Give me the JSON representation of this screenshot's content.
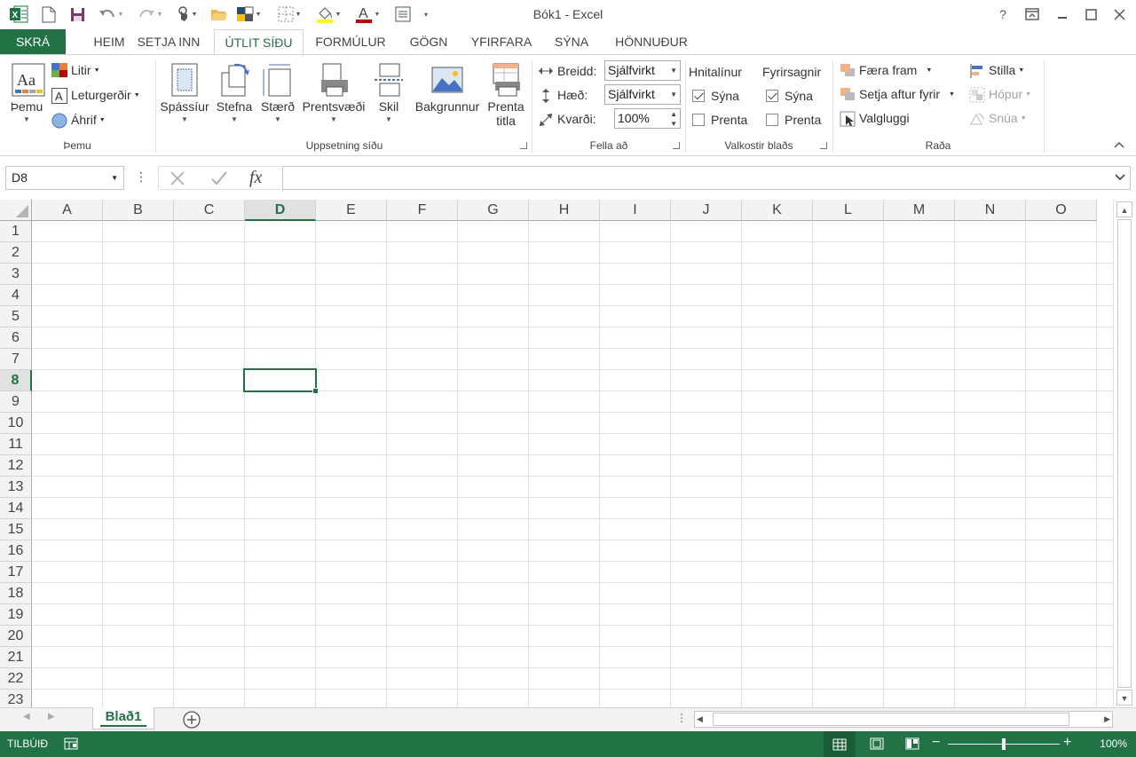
{
  "window": {
    "title": "Bók1 - Excel",
    "help": "?",
    "restore_ribbon": "⧉",
    "minimize": "—",
    "maximize": "☐",
    "close": "✕"
  },
  "tabs": [
    {
      "label": "SKRÁ"
    },
    {
      "label": "HEIM"
    },
    {
      "label": "SETJA INN"
    },
    {
      "label": "ÚTLIT SÍÐU"
    },
    {
      "label": "FORMÚLUR"
    },
    {
      "label": "GÖGN"
    },
    {
      "label": "YFIRFARA"
    },
    {
      "label": "SÝNA"
    },
    {
      "label": "HÖNNUÐUR"
    }
  ],
  "ribbon": {
    "themes": {
      "group_label": "Þemu",
      "themes_btn": "Þemu",
      "colors": "Litir",
      "fonts": "Leturgerðir",
      "effects": "Áhrif"
    },
    "page_setup": {
      "group_label": "Uppsetning síðu",
      "margins": "Spássíur",
      "orientation": "Stefna",
      "size": "Stærð",
      "print_area": "Prentsvæði",
      "breaks": "Skil",
      "background": "Bakgrunnur",
      "print_titles_1": "Prenta",
      "print_titles_2": "titla"
    },
    "scale": {
      "group_label": "Fella að",
      "width_label": "Breidd:",
      "width_value": "Sjálfvirkt",
      "height_label": "Hæð:",
      "height_value": "Sjálfvirkt",
      "scale_label": "Kvarði:",
      "scale_value": "100%"
    },
    "sheet_options": {
      "group_label": "Valkostir blaðs",
      "gridlines": "Hnitalínur",
      "headings": "Fyrirsagnir",
      "view": "Sýna",
      "print": "Prenta"
    },
    "arrange": {
      "group_label": "Raða",
      "bring_forward": "Færa fram",
      "send_backward": "Setja aftur fyrir",
      "selection_pane": "Valgluggi",
      "align": "Stilla",
      "group": "Hópur",
      "rotate": "Snúa"
    }
  },
  "formula_bar": {
    "name_box": "D8",
    "formula": ""
  },
  "grid": {
    "columns": [
      "A",
      "B",
      "C",
      "D",
      "E",
      "F",
      "G",
      "H",
      "I",
      "J",
      "K",
      "L",
      "M",
      "N",
      "O"
    ],
    "rows": [
      "1",
      "2",
      "3",
      "4",
      "5",
      "6",
      "7",
      "8",
      "9",
      "10",
      "11",
      "12",
      "13",
      "14",
      "15",
      "16",
      "17",
      "18",
      "19",
      "20",
      "21",
      "22",
      "23"
    ],
    "selected_column": "D",
    "selected_row": "8"
  },
  "sheets": {
    "active": "Blað1"
  },
  "status": {
    "ready": "TILBÚIÐ",
    "zoom": "100%",
    "zoom_level": 0.5
  },
  "colors": {
    "accent": "#217346",
    "font_red": "#c00000",
    "highlight_yellow": "#ffff00"
  }
}
